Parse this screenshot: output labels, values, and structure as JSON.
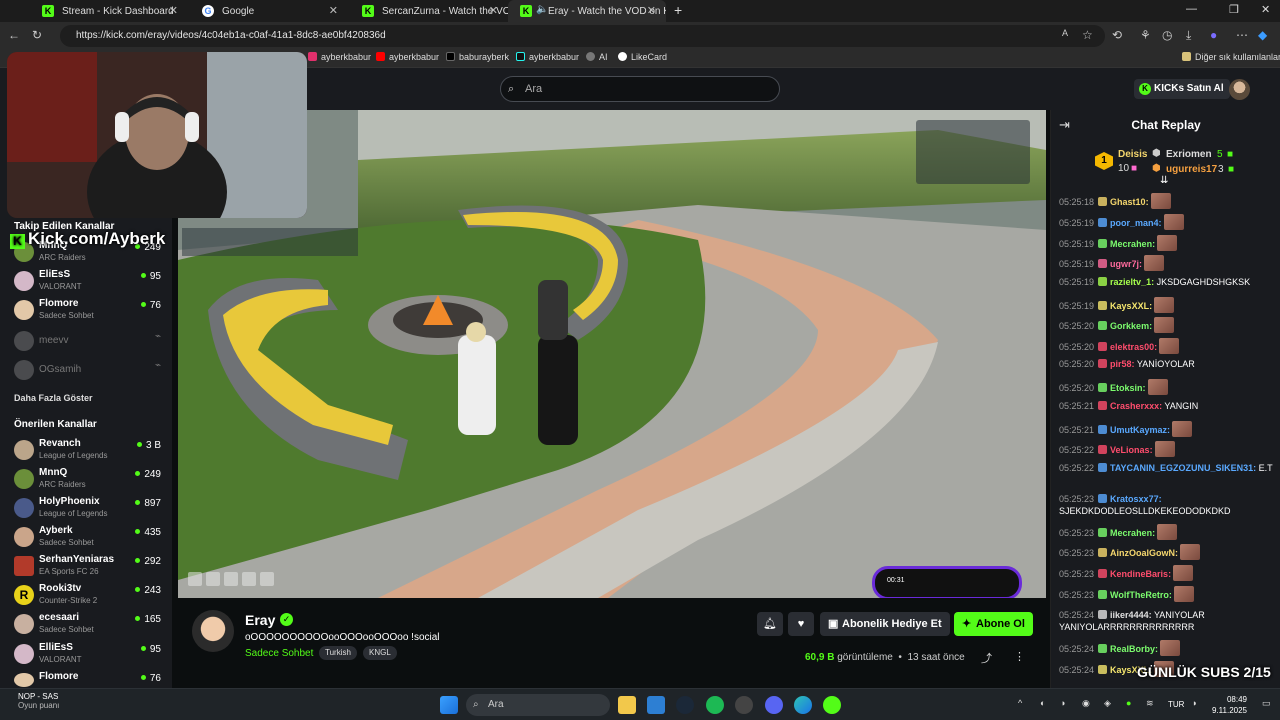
{
  "browser": {
    "tabs": [
      {
        "title": "Stream - Kick Dashboard"
      },
      {
        "title": "Google"
      },
      {
        "title": "SercanZurna - Watch the VOD on Kick"
      },
      {
        "title": "Eray - Watch the VOD on Kick"
      }
    ],
    "url": "https://kick.com/eray/videos/4c04eb1a-c0af-41a1-8dc8-ae0bf420836d",
    "bookmarks": [
      "ayberkbabur",
      "ayberkbabur",
      "baburayberk",
      "ayberkbabur",
      "AI",
      "LikeCard"
    ],
    "other_bookmarks": "Diğer sık kullanılanlar"
  },
  "header": {
    "search_placeholder": "Ara",
    "kicks_button": "KICKs Satın Al"
  },
  "webcam": {
    "brand": "Kick.com/Ayberk"
  },
  "sidebar": {
    "followed_title": "Takip Edilen Kanallar",
    "followed": [
      {
        "name": "MnnQ",
        "game": "ARC Raiders",
        "viewers": "249"
      },
      {
        "name": "EliEsS",
        "game": "VALORANT",
        "viewers": "95"
      },
      {
        "name": "Flomore",
        "game": "Sadece Sohbet",
        "viewers": "76"
      },
      {
        "name": "meevv"
      },
      {
        "name": "OGsamih"
      }
    ],
    "show_more": "Daha Fazla Göster",
    "recommended_title": "Önerilen Kanallar",
    "recommended": [
      {
        "name": "Revanch",
        "game": "League of Legends",
        "viewers": "3 B"
      },
      {
        "name": "MnnQ",
        "game": "ARC Raiders",
        "viewers": "249"
      },
      {
        "name": "HolyPhoenix",
        "game": "League of Legends",
        "viewers": "897"
      },
      {
        "name": "Ayberk",
        "game": "Sadece Sohbet",
        "viewers": "435"
      },
      {
        "name": "SerhanYeniaras",
        "game": "EA Sports FC 26",
        "viewers": "292"
      },
      {
        "name": "Rooki3tv",
        "game": "Counter-Strike 2",
        "viewers": "243"
      },
      {
        "name": "ecesaari",
        "game": "Sadece Sohbet",
        "viewers": "165"
      },
      {
        "name": "ElliEsS",
        "game": "VALORANT",
        "viewers": "95"
      },
      {
        "name": "Flomore",
        "game": "",
        "viewers": "76"
      }
    ]
  },
  "video": {
    "phone_time": "00:31"
  },
  "stream": {
    "name": "Eray",
    "title": "oOOOOOOOOOOooOOOooOOOoo !social",
    "category": "Sadece Sohbet",
    "tags": [
      "Turkish",
      "KNGL"
    ],
    "gift_label": "Abonelik Hediye Et",
    "subscribe_label": "Abone Ol",
    "views_number": "60,9 B",
    "views_label": "görüntüleme",
    "time_ago": "13 saat önce"
  },
  "chat": {
    "title": "Chat Replay",
    "leaderboard": [
      {
        "name": "Deisis",
        "count": "10"
      },
      {
        "name": "Exriomen",
        "count": "5"
      },
      {
        "name": "ugurreis17",
        "count": "3"
      }
    ],
    "messages": [
      {
        "time": "05:25:18",
        "user": "Ghast10:",
        "text": "",
        "color": "#f5d76e",
        "emote": true
      },
      {
        "time": "05:25:19",
        "user": "poor_man4:",
        "text": "",
        "color": "#5aa9ff",
        "emote": true
      },
      {
        "time": "05:25:19",
        "user": "Mecrahen:",
        "text": "",
        "color": "#7cfc6e",
        "emote": true
      },
      {
        "time": "05:25:19",
        "user": "ugwr7j:",
        "text": "",
        "color": "#ff6b9d",
        "emote": true
      },
      {
        "time": "05:25:19",
        "user": "razieltv_1:",
        "text": "JKSDGAGHDSHGKSK",
        "color": "#a6ff4d",
        "emote": false
      },
      {
        "time": "05:25:19",
        "user": "KaysXXL:",
        "text": "",
        "color": "#f5e66e",
        "emote": true
      },
      {
        "time": "05:25:20",
        "user": "Gorkkem:",
        "text": "",
        "color": "#7cfc6e",
        "emote": true
      },
      {
        "time": "05:25:20",
        "user": "elektras00:",
        "text": "",
        "color": "#ff4d6d",
        "emote": true
      },
      {
        "time": "05:25:20",
        "user": "pir58:",
        "text": "YANİOYOLAR",
        "color": "#ff4d6d",
        "emote": false
      },
      {
        "time": "05:25:20",
        "user": "Etoksin:",
        "text": "",
        "color": "#7cfc6e",
        "emote": true
      },
      {
        "time": "05:25:21",
        "user": "Crasherxxx:",
        "text": "YANGIN",
        "color": "#ff4d6d",
        "emote": false
      },
      {
        "time": "05:25:21",
        "user": "UmutKaymaz:",
        "text": "",
        "color": "#5aa9ff",
        "emote": true
      },
      {
        "time": "05:25:22",
        "user": "VeLionas:",
        "text": "",
        "color": "#ff4d6d",
        "emote": true
      },
      {
        "time": "05:25:22",
        "user": "TAYCANIN_EGZOZUNU_SIKEN31:",
        "text": "E.T",
        "color": "#5aa9ff",
        "emote": false
      },
      {
        "time": "05:25:23",
        "user": "Kratosxx77:",
        "text": "SJEKDKDODLEOSLLDKEKEODODKDKD",
        "color": "#5aa9ff",
        "emote": false
      },
      {
        "time": "05:25:23",
        "user": "Mecrahen:",
        "text": "",
        "color": "#7cfc6e",
        "emote": true
      },
      {
        "time": "05:25:23",
        "user": "AinzOoalGowN:",
        "text": "",
        "color": "#f5d76e",
        "emote": true
      },
      {
        "time": "05:25:23",
        "user": "KendineBaris:",
        "text": "",
        "color": "#ff4d6d",
        "emote": true
      },
      {
        "time": "05:25:23",
        "user": "WolfTheRetro:",
        "text": "",
        "color": "#7cfc6e",
        "emote": true
      },
      {
        "time": "05:25:24",
        "user": "iiker4444:",
        "text": "YANIYOLAR YANIYOLARRRRRRRRRRRRRR",
        "color": "#e0e0e0",
        "emote": false
      },
      {
        "time": "05:25:24",
        "user": "RealBorby:",
        "text": "",
        "color": "#7cfc6e",
        "emote": true
      },
      {
        "time": "05:25:24",
        "user": "KaysXXL:",
        "text": "",
        "color": "#f5e66e",
        "emote": true
      }
    ],
    "subs_overlay": "GÜNLÜK SUBS 2/15"
  },
  "taskbar": {
    "weather_title": "NOP - SAS",
    "weather_sub": "Oyun puanı",
    "search": "Ara",
    "lang": "TUR",
    "time": "08:49",
    "date": "9.11.2025"
  },
  "colors": {
    "kick_green": "#53fc18",
    "bg": "#0b0e0f",
    "panel": "#191b1f"
  }
}
